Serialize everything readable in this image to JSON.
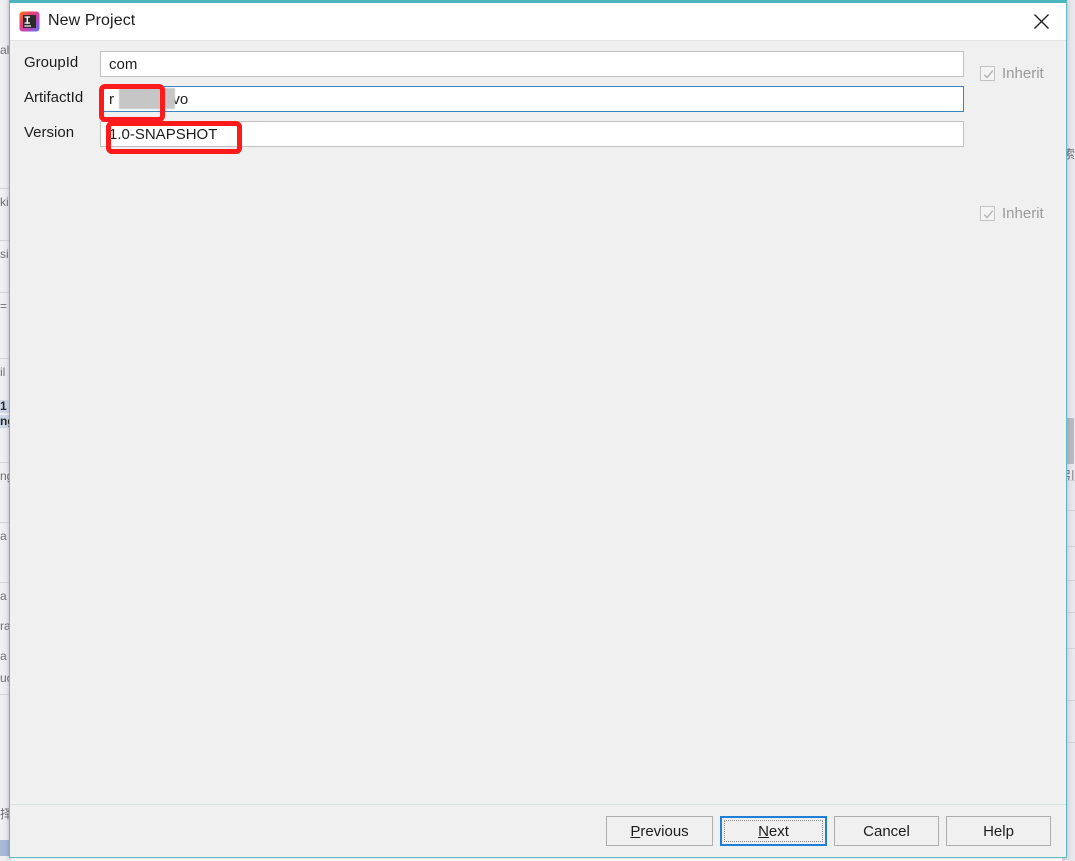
{
  "dialog": {
    "title": "New Project",
    "app_icon": "intellij-idea-icon",
    "close_icon": "close-icon"
  },
  "form": {
    "rows": [
      {
        "label": "GroupId",
        "value": "com",
        "placeholder": "",
        "focused": false,
        "inherit": {
          "label": "Inherit",
          "checked": true,
          "disabled": true
        }
      },
      {
        "label": "ArtifactId",
        "value": "r",
        "value_suffix": "vo",
        "placeholder": "",
        "focused": true,
        "redacted": true,
        "inherit": null
      },
      {
        "label": "Version",
        "value": "1.0-SNAPSHOT",
        "placeholder": "",
        "focused": false,
        "inherit": {
          "label": "Inherit",
          "checked": true,
          "disabled": true
        }
      }
    ]
  },
  "annotations": [
    {
      "name": "groupid-highlight",
      "color": "#fd1a1a"
    },
    {
      "name": "artifactid-highlight",
      "color": "#fd1a1a"
    }
  ],
  "buttons": {
    "previous": {
      "prefix": "",
      "mnemonic": "P",
      "suffix": "revious"
    },
    "next": {
      "prefix": "",
      "mnemonic": "N",
      "suffix": "ext",
      "default": true
    },
    "cancel": {
      "label": "Cancel"
    },
    "help": {
      "label": "Help"
    }
  },
  "background_window": {
    "left_fragments": [
      "al",
      "ki",
      "si",
      "=",
      "il",
      "1",
      "ng",
      "ng",
      "a",
      "a",
      "ra",
      "a",
      "uc",
      "择"
    ],
    "right_fragments": [
      "索",
      "引"
    ]
  },
  "colors": {
    "dialog_border": "#4cb5bd",
    "focus_border": "#3d81c2",
    "default_button_border": "#1e7fd4",
    "annotation": "#fd1a1a",
    "body_background": "#f0f0f0"
  }
}
